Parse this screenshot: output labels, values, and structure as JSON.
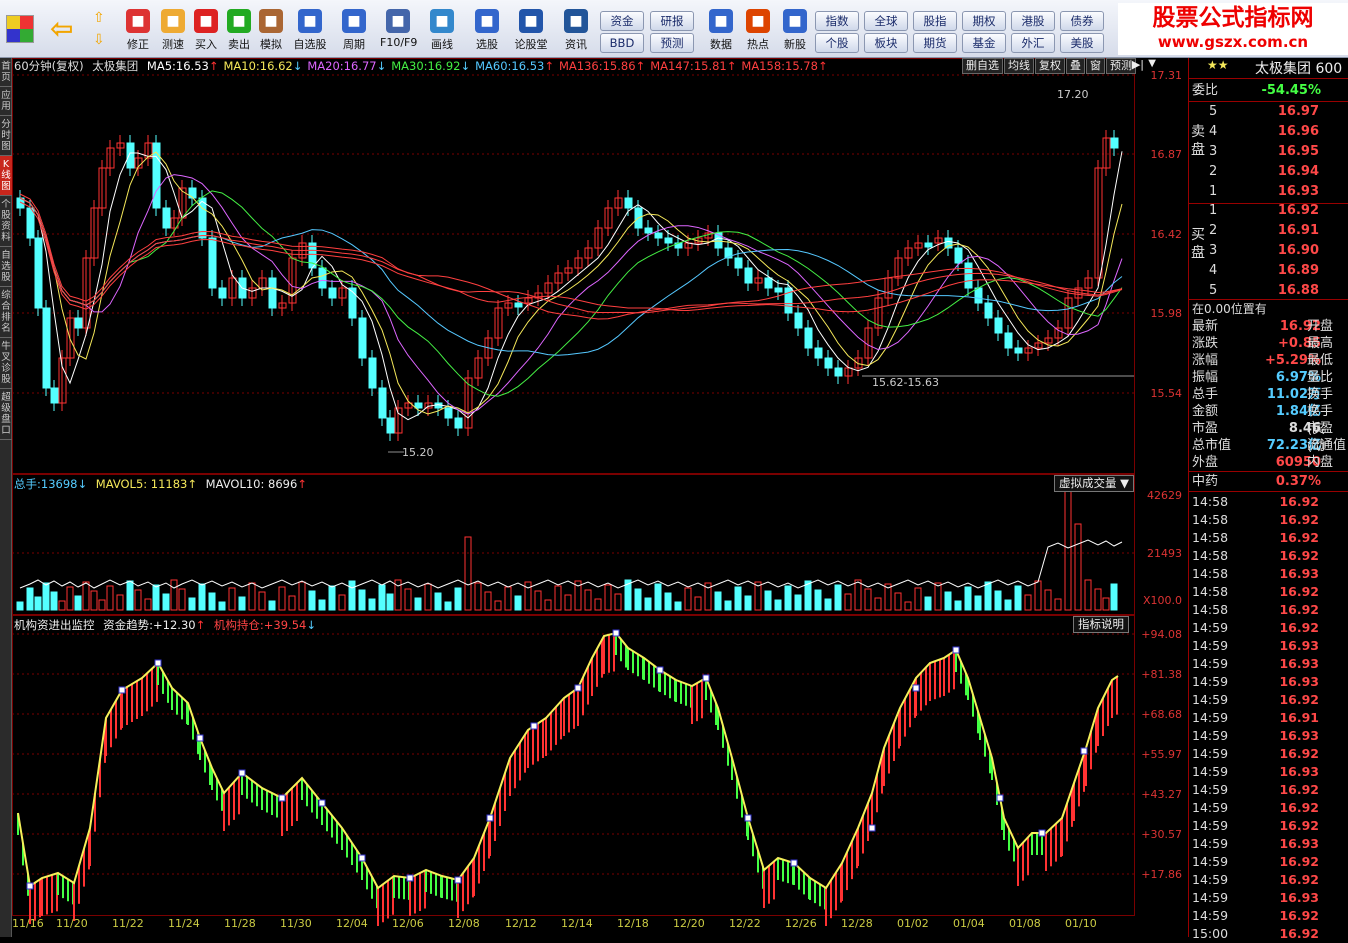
{
  "toolbar": {
    "buttons": [
      "修正",
      "测速",
      "买入",
      "卖出",
      "模拟",
      "自选股",
      "周期",
      "F10/F9",
      "画线",
      "选股",
      "论股堂",
      "资讯",
      "数据",
      "热点",
      "新股"
    ],
    "grid1": [
      "资金",
      "研报",
      "BBD",
      "预测"
    ],
    "grid2": [
      "指数",
      "全球",
      "股指",
      "期权",
      "港股",
      "债券",
      "个股",
      "板块",
      "期货",
      "基金",
      "外汇",
      "美股"
    ],
    "brand_line1": "股票公式指标网",
    "brand_line2": "www.gszx.com.cn"
  },
  "left_tabs": [
    "首页",
    "应用",
    "分时图",
    "K线图",
    "个股资料",
    "自选股",
    "综合排名",
    "牛叉诊股",
    "超级盘口"
  ],
  "kline": {
    "period": "60分钟(复权)",
    "stock": "太极集团",
    "ma": [
      {
        "label": "MA5:",
        "value": "16.53",
        "dir": "↑",
        "color": "#ffffff"
      },
      {
        "label": "MA10:",
        "value": "16.62",
        "dir": "↓",
        "color": "#f5e85a"
      },
      {
        "label": "MA20:",
        "value": "16.77",
        "dir": "↓",
        "color": "#dd66ff"
      },
      {
        "label": "MA30:",
        "value": "16.92",
        "dir": "↓",
        "color": "#44ee44"
      },
      {
        "label": "MA60:",
        "value": "16.53",
        "dir": "↑",
        "color": "#55c8ff"
      },
      {
        "label": "MA136:",
        "value": "15.86",
        "dir": "↑",
        "color": "#ff4040"
      },
      {
        "label": "MA147:",
        "value": "15.81",
        "dir": "↑",
        "color": "#ff4040"
      },
      {
        "label": "MA158:",
        "value": "15.78",
        "dir": "↑",
        "color": "#ff4040"
      }
    ],
    "buttons": [
      "删自选",
      "均线",
      "复权",
      "叠",
      "窗",
      "预测"
    ],
    "y_labels": [
      "17.31",
      "16.87",
      "16.42",
      "15.98",
      "15.54"
    ],
    "high_note": "17.20",
    "low_note": "15.20",
    "range_note": "15.62-15.63"
  },
  "volume": {
    "total_label": "总手:",
    "total": "13698",
    "mavol5": "MAVOL5: 11183",
    "mavol10": "MAVOL10: 8696",
    "button": "虚拟成交量",
    "y_labels": [
      "42629",
      "21493",
      "X100.0"
    ]
  },
  "indicator": {
    "name": "机构资进出监控",
    "trend_label": "资金趋势:",
    "trend": "+12.30",
    "hold_label": "机构持仓:",
    "hold": "+39.54",
    "button": "指标说明",
    "y_labels": [
      "+94.08",
      "+81.38",
      "+68.68",
      "+55.97",
      "+43.27",
      "+30.57",
      "+17.86"
    ]
  },
  "x_axis": [
    "11/16",
    "11/20",
    "11/22",
    "11/24",
    "11/28",
    "11/30",
    "12/04",
    "12/06",
    "12/08",
    "12/12",
    "12/14",
    "12/18",
    "12/20",
    "12/22",
    "12/26",
    "12/28",
    "01/02",
    "01/04",
    "01/08",
    "01/10"
  ],
  "panel": {
    "stars": "★★",
    "name": "太极集团 600",
    "weibi_label": "委比",
    "weibi": "-54.45%",
    "sell_label": "卖盘",
    "buy_label": "买盘",
    "sell": [
      {
        "n": "5",
        "p": "16.97"
      },
      {
        "n": "4",
        "p": "16.96"
      },
      {
        "n": "3",
        "p": "16.95"
      },
      {
        "n": "2",
        "p": "16.94"
      },
      {
        "n": "1",
        "p": "16.93"
      }
    ],
    "buy": [
      {
        "n": "1",
        "p": "16.92"
      },
      {
        "n": "2",
        "p": "16.91"
      },
      {
        "n": "3",
        "p": "16.90"
      },
      {
        "n": "4",
        "p": "16.89"
      },
      {
        "n": "5",
        "p": "16.88"
      }
    ],
    "position": "在0.00位置有",
    "stats": [
      {
        "a": "最新",
        "b": "16.92",
        "c": "开盘"
      },
      {
        "a": "涨跌",
        "b": "+0.85",
        "c": "最高"
      },
      {
        "a": "涨幅",
        "b": "+5.29%",
        "c": "最低"
      },
      {
        "a": "振幅",
        "b": "6.97%",
        "c": "量比"
      },
      {
        "a": "总手",
        "b": "11.02万",
        "c": "换手"
      },
      {
        "a": "金额",
        "b": "1.84亿",
        "c": "换手(实"
      },
      {
        "a": "市盈",
        "b": "8.46",
        "c": "市盈(动"
      },
      {
        "a": "总市值",
        "b": "72.23亿",
        "c": "流通值"
      },
      {
        "a": "外盘",
        "b": "60950",
        "c": "内盘"
      }
    ],
    "sector": "中药",
    "sector_pct": "0.37%",
    "ticks": [
      {
        "t": "14:58",
        "p": "16.92"
      },
      {
        "t": "14:58",
        "p": "16.92"
      },
      {
        "t": "14:58",
        "p": "16.92"
      },
      {
        "t": "14:58",
        "p": "16.92"
      },
      {
        "t": "14:58",
        "p": "16.93"
      },
      {
        "t": "14:58",
        "p": "16.92"
      },
      {
        "t": "14:58",
        "p": "16.92"
      },
      {
        "t": "14:59",
        "p": "16.92"
      },
      {
        "t": "14:59",
        "p": "16.93"
      },
      {
        "t": "14:59",
        "p": "16.93"
      },
      {
        "t": "14:59",
        "p": "16.93"
      },
      {
        "t": "14:59",
        "p": "16.92"
      },
      {
        "t": "14:59",
        "p": "16.91"
      },
      {
        "t": "14:59",
        "p": "16.93"
      },
      {
        "t": "14:59",
        "p": "16.92"
      },
      {
        "t": "14:59",
        "p": "16.93"
      },
      {
        "t": "14:59",
        "p": "16.92"
      },
      {
        "t": "14:59",
        "p": "16.92"
      },
      {
        "t": "14:59",
        "p": "16.92"
      },
      {
        "t": "14:59",
        "p": "16.93"
      },
      {
        "t": "14:59",
        "p": "16.92"
      },
      {
        "t": "14:59",
        "p": "16.92"
      },
      {
        "t": "14:59",
        "p": "16.93"
      },
      {
        "t": "14:59",
        "p": "16.92"
      },
      {
        "t": "15:00",
        "p": "16.92"
      }
    ]
  },
  "colors": {
    "up": "#ff3232",
    "down": "#54ffff",
    "grid": "#7a0000",
    "accent": "#e00000"
  }
}
